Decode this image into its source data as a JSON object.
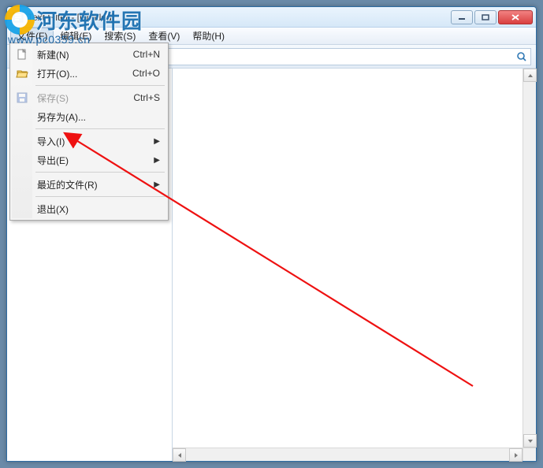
{
  "window": {
    "title": "Text Filter - [Untitled]"
  },
  "menubar": {
    "file": "文件(F)",
    "edit": "编辑(E)",
    "search": "搜索(S)",
    "view": "查看(V)",
    "help": "帮助(H)"
  },
  "dropdown": {
    "new_label": "新建(N)",
    "new_shortcut": "Ctrl+N",
    "open_label": "打开(O)...",
    "open_shortcut": "Ctrl+O",
    "save_label": "保存(S)",
    "save_shortcut": "Ctrl+S",
    "save_as_label": "另存为(A)...",
    "import_label": "导入(I)",
    "export_label": "导出(E)",
    "recent_label": "最近的文件(R)",
    "exit_label": "退出(X)"
  },
  "watermark": {
    "brand": "河东软件园",
    "url": "www.pc0359.cn"
  },
  "icons": {
    "app": "app-icon",
    "minimize": "minimize-icon",
    "maximize": "maximize-icon",
    "close": "close-icon",
    "new": "new-file-icon",
    "open": "open-folder-icon",
    "save": "save-icon",
    "search": "search-icon"
  }
}
